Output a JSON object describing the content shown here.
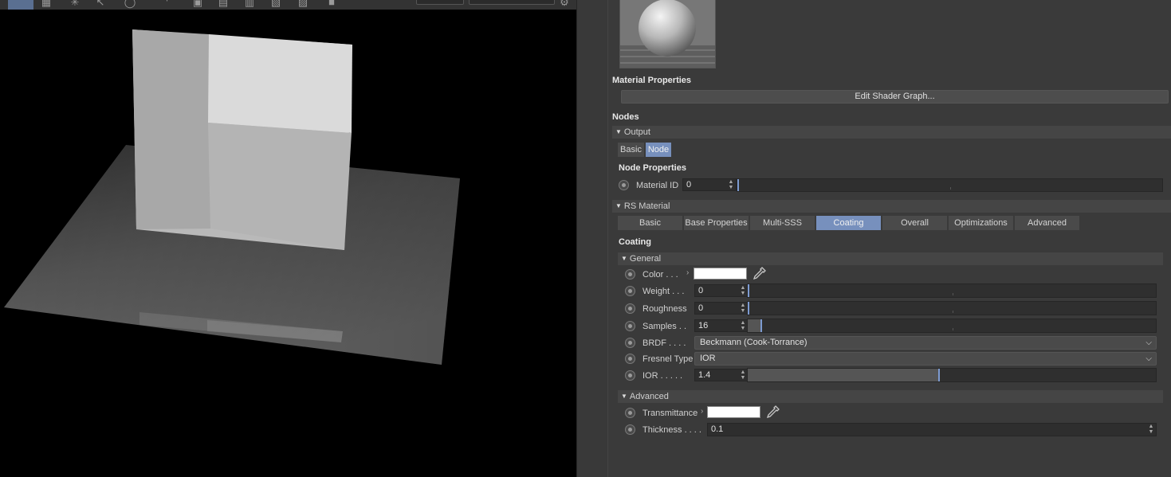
{
  "panel": {
    "material_properties_title": "Material Properties",
    "edit_shader_graph_label": "Edit Shader Graph...",
    "nodes_title": "Nodes",
    "output_group": "Output",
    "output_tabs": [
      "Basic",
      "Node"
    ],
    "output_active_tab": "Node",
    "node_properties_title": "Node Properties",
    "material_id_label": "Material ID",
    "material_id_value": "0",
    "rs_material_group": "RS Material",
    "rs_tabs": [
      "Basic",
      "Base Properties",
      "Multi-SSS",
      "Coating",
      "Overall",
      "Optimizations",
      "Advanced"
    ],
    "rs_active_tab": "Coating",
    "coating_title": "Coating",
    "general_group": "General",
    "color_label": "Color . . .",
    "color_value": "#ffffff",
    "weight_label": "Weight . . .",
    "weight_value": "0",
    "roughness_label": "Roughness",
    "roughness_value": "0",
    "samples_label": "Samples . .",
    "samples_value": "16",
    "brdf_label": "BRDF . . . .",
    "brdf_value": "Beckmann (Cook-Torrance)",
    "fresnel_label": "Fresnel Type",
    "fresnel_value": "IOR",
    "ior_label": "IOR . . . . .",
    "ior_value": "1.4",
    "advanced_group": "Advanced",
    "transmittance_label": "Transmittance",
    "transmittance_value": "#ffffff",
    "thickness_label": "Thickness . . . .",
    "thickness_value": "0.1"
  },
  "sliders": {
    "material_id_fraction": 0.0,
    "weight_fraction": 0.0,
    "roughness_fraction": 0.0,
    "samples_fraction": 0.03,
    "ior_fraction": 0.47
  },
  "colors": {
    "accent": "#7790bd",
    "panel_bg": "#3a3a3a",
    "viewport_bg": "#000000"
  },
  "icons": [
    "dropper-icon",
    "chevron-down-icon",
    "triangle-down-icon",
    "radio-icon",
    "spinner-icon"
  ]
}
